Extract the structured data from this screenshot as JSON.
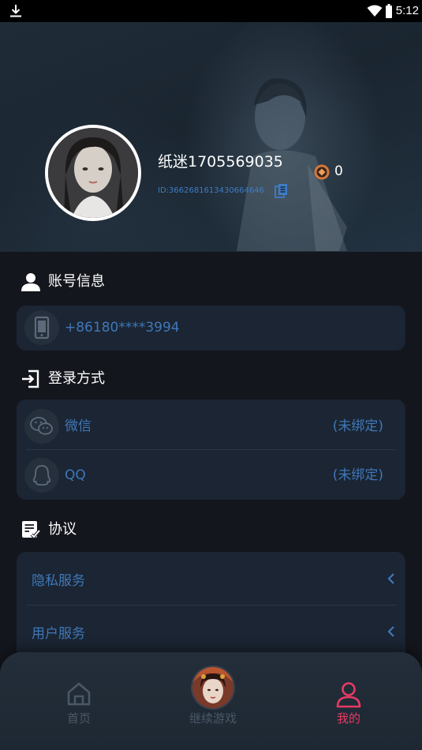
{
  "status_bar": {
    "time": "5:12",
    "icons": [
      "download-icon",
      "wifi-icon",
      "battery-icon"
    ]
  },
  "profile": {
    "username": "纸迷1705569035",
    "user_id": "ID:3662681613430664646",
    "coin_count": "0",
    "icons": [
      "copy-icon",
      "coin-icon"
    ]
  },
  "account_section": {
    "title": "账号信息",
    "icon": "user-icon",
    "phone": "+86180****3994",
    "phone_icon": "phone-icon"
  },
  "login_section": {
    "title": "登录方式",
    "icon": "login-icon",
    "methods": [
      {
        "label": "微信",
        "status": "(未绑定)",
        "icon": "wechat-icon"
      },
      {
        "label": "QQ",
        "status": "(未绑定)",
        "icon": "qq-icon"
      }
    ]
  },
  "protocol_section": {
    "title": "协议",
    "icon": "document-check-icon",
    "items": [
      {
        "label": "隐私服务",
        "icon": "chevron-left-icon"
      },
      {
        "label": "用户服务",
        "icon": "chevron-left-icon"
      }
    ]
  },
  "bottom_nav": {
    "items": [
      {
        "label": "首页",
        "icon": "home-icon",
        "active": false
      },
      {
        "label": "继续游戏",
        "icon": "game-avatar",
        "active": false
      },
      {
        "label": "我的",
        "icon": "profile-icon",
        "active": true
      }
    ]
  },
  "colors": {
    "background": "#14161d",
    "card": "#1b2533",
    "link_blue": "#3f78b8",
    "active_nav": "#e83a63",
    "coin": "#d4793a"
  }
}
